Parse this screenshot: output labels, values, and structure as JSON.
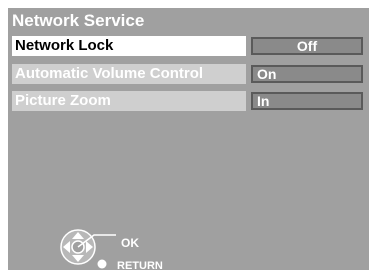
{
  "header": {
    "title": "Network Service"
  },
  "settings": [
    {
      "label": "Network Lock",
      "value": "Off"
    },
    {
      "label": "Automatic Volume Control",
      "value": "On"
    },
    {
      "label": "Picture Zoom",
      "value": "In"
    }
  ],
  "footer": {
    "ok_label": "OK",
    "return_label": "RETURN"
  },
  "colors": {
    "panel_bg": "#a0a0a0",
    "highlight": "#ffffff",
    "value_box": "#8a8a8a"
  }
}
